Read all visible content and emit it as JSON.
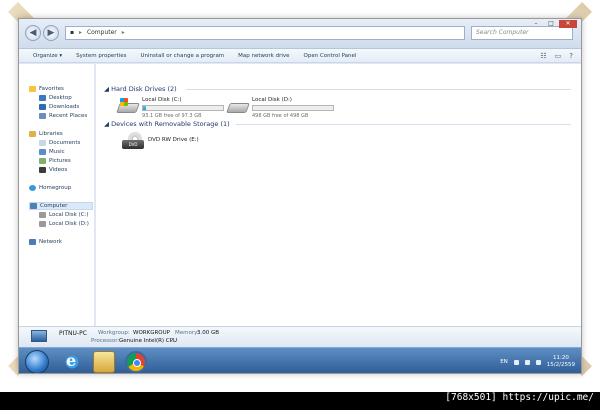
{
  "window": {
    "address": {
      "root": "Computer",
      "current": "Computer"
    },
    "search_placeholder": "Search Computer",
    "controls": {
      "minimize": "–",
      "maximize": "□",
      "close": "✕"
    }
  },
  "toolbar": {
    "items": [
      "Organize ▾",
      "System properties",
      "Uninstall or change a program",
      "Map network drive",
      "Open Control Panel"
    ]
  },
  "sidebar": {
    "favorites": {
      "label": "Favorites",
      "items": [
        "Desktop",
        "Downloads",
        "Recent Places"
      ]
    },
    "libraries": {
      "label": "Libraries",
      "items": [
        "Documents",
        "Music",
        "Pictures",
        "Videos"
      ]
    },
    "homegroup": "Homegroup",
    "computer": {
      "label": "Computer",
      "items": [
        "Local Disk (C:)",
        "Local Disk (D:)"
      ]
    },
    "network": "Network"
  },
  "main": {
    "hdd_group": "Hard Disk Drives (2)",
    "removable_group": "Devices with Removable Storage (1)",
    "drives": [
      {
        "name": "Local Disk (C:)",
        "free": "93.1 GB free of 97.3 GB",
        "used_fraction": 0.04
      },
      {
        "name": "Local Disk (D:)",
        "free": "498 GB free of 498 GB",
        "used_fraction": 0.0
      }
    ],
    "dvd": {
      "name": "DVD RW Drive (E:)",
      "logo_text": "DVD"
    }
  },
  "details": {
    "pc_name": "PITNU-PC",
    "workgroup_label": "Workgroup:",
    "workgroup_value": "WORKGROUP",
    "memory_label": "Memory:",
    "memory_value": "3.00 GB",
    "processor_label": "Processor:",
    "processor_value": "Genuine Intel(R) CPU",
    "processor_more": "..."
  },
  "taskbar": {
    "language": "EN",
    "time": "11:20",
    "date": "15/2/2559"
  },
  "watermark": "[768x501] https://upic.me/"
}
